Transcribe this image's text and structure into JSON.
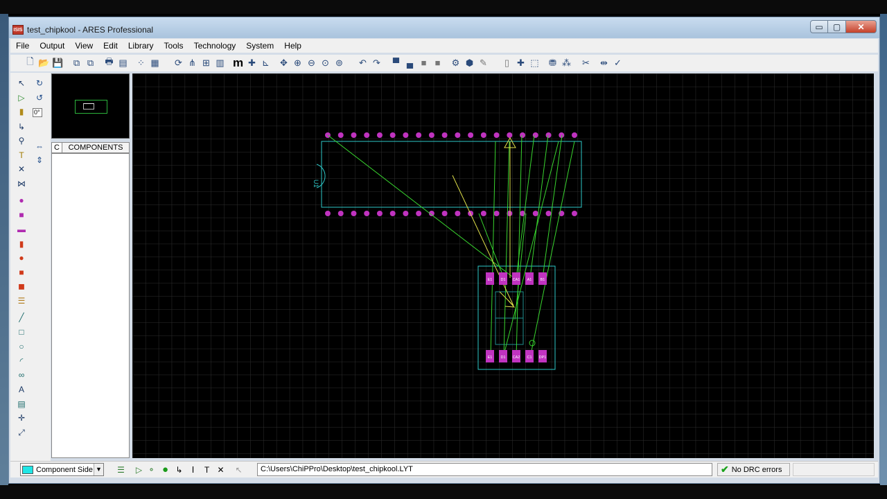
{
  "window": {
    "title": "test_chipkool - ARES Professional",
    "app_icon_text": "ISIS"
  },
  "window_controls": {
    "minimize": "▭",
    "maximize": "▢",
    "close": "✕"
  },
  "menu": [
    {
      "label": "File"
    },
    {
      "label": "Output"
    },
    {
      "label": "View"
    },
    {
      "label": "Edit"
    },
    {
      "label": "Library"
    },
    {
      "label": "Tools"
    },
    {
      "label": "Technology"
    },
    {
      "label": "System"
    },
    {
      "label": "Help"
    }
  ],
  "toolbar": {
    "items": [
      {
        "name": "new-icon",
        "glyph": "🗋"
      },
      {
        "name": "open-icon",
        "glyph": "📂"
      },
      {
        "name": "save-icon",
        "glyph": "💾"
      },
      {
        "name": "import-icon",
        "glyph": "⧉"
      },
      {
        "name": "export-icon",
        "glyph": "⧉"
      },
      {
        "name": "print-icon",
        "glyph": "🖶"
      },
      {
        "name": "print-area-icon",
        "glyph": "▤"
      },
      {
        "name": "grid-dots-icon",
        "glyph": "⁘"
      },
      {
        "name": "grid-icon",
        "glyph": "▦"
      },
      {
        "name": "refresh-icon",
        "glyph": "⟳"
      },
      {
        "name": "mirror-icon",
        "glyph": "⋔"
      },
      {
        "name": "snap-grid-icon",
        "glyph": "⊞"
      },
      {
        "name": "layers-icon",
        "glyph": "▥"
      },
      {
        "name": "metric-icon",
        "glyph": "m"
      },
      {
        "name": "origin-icon",
        "glyph": "✚"
      },
      {
        "name": "cursor-origin-icon",
        "glyph": "⊾"
      },
      {
        "name": "pan-icon",
        "glyph": "✥"
      },
      {
        "name": "zoom-in-icon",
        "glyph": "⊕"
      },
      {
        "name": "zoom-out-icon",
        "glyph": "⊖"
      },
      {
        "name": "zoom-all-icon",
        "glyph": "⊙"
      },
      {
        "name": "zoom-area-icon",
        "glyph": "⊚"
      },
      {
        "name": "undo-icon",
        "glyph": "↶"
      },
      {
        "name": "redo-icon",
        "glyph": "↷"
      },
      {
        "name": "block-copy-icon",
        "glyph": "▀"
      },
      {
        "name": "block-move-icon",
        "glyph": "▄"
      },
      {
        "name": "block-rotate-icon",
        "glyph": "■"
      },
      {
        "name": "block-delete-icon",
        "glyph": "■"
      },
      {
        "name": "pick-library-icon",
        "glyph": "⚙"
      },
      {
        "name": "make-package-icon",
        "glyph": "⬢"
      },
      {
        "name": "decompose-icon",
        "glyph": "✎"
      },
      {
        "name": "page-icon",
        "glyph": "▯"
      },
      {
        "name": "autoplace-icon",
        "glyph": "✚"
      },
      {
        "name": "autoroute-icon",
        "glyph": "⬚"
      },
      {
        "name": "search-tag-icon",
        "glyph": "⛃"
      },
      {
        "name": "property-assign-icon",
        "glyph": "⁂"
      },
      {
        "name": "gateswap-icon",
        "glyph": "✂"
      },
      {
        "name": "tidy-icon",
        "glyph": "⇹"
      },
      {
        "name": "drc-check-icon",
        "glyph": "✓"
      }
    ]
  },
  "side_toolbar": {
    "angle_value": "0°",
    "items": [
      {
        "name": "selection-mode-icon",
        "glyph": "↖"
      },
      {
        "name": "component-mode-icon",
        "glyph": "▷"
      },
      {
        "name": "package-mode-icon",
        "glyph": "▮"
      },
      {
        "name": "track-mode-icon",
        "glyph": "↳"
      },
      {
        "name": "via-mode-icon",
        "glyph": "⚲"
      },
      {
        "name": "zone-mode-icon",
        "glyph": "T"
      },
      {
        "name": "ratsnest-mode-icon",
        "glyph": "✕"
      },
      {
        "name": "connectivity-mode-icon",
        "glyph": "⋈"
      },
      {
        "name": "round-pad-icon",
        "glyph": "●"
      },
      {
        "name": "square-pad-icon",
        "glyph": "■"
      },
      {
        "name": "dil-pad-icon",
        "glyph": "▬"
      },
      {
        "name": "edge-pad-icon",
        "glyph": "▮"
      },
      {
        "name": "circular-smt-pad-icon",
        "glyph": "●"
      },
      {
        "name": "rectangular-smt-pad-icon",
        "glyph": "■"
      },
      {
        "name": "polygonal-smt-pad-icon",
        "glyph": "◼"
      },
      {
        "name": "padstack-icon",
        "glyph": "☰"
      },
      {
        "name": "line-icon",
        "glyph": "╱"
      },
      {
        "name": "box-icon",
        "glyph": "□"
      },
      {
        "name": "circle-icon",
        "glyph": "○"
      },
      {
        "name": "arc-icon",
        "glyph": "◜"
      },
      {
        "name": "path-icon",
        "glyph": "∞"
      },
      {
        "name": "text-icon",
        "glyph": "A"
      },
      {
        "name": "symbol-icon",
        "glyph": "▤"
      },
      {
        "name": "marker-icon",
        "glyph": "✛"
      },
      {
        "name": "dimension-icon",
        "glyph": "⤢"
      }
    ],
    "rotate_icons": [
      {
        "name": "rotate-clockwise-icon",
        "glyph": "↻"
      },
      {
        "name": "rotate-anticlockwise-icon",
        "glyph": "↺"
      },
      {
        "name": "flip-horizontal-icon",
        "glyph": "⇔"
      },
      {
        "name": "flip-vertical-icon",
        "glyph": "⇕"
      }
    ]
  },
  "component_panel": {
    "tab_letter": "C",
    "title": "COMPONENTS"
  },
  "pcb": {
    "colors": {
      "grid": "#2e2e2e",
      "outline": "#2ec8c8",
      "pad": "#c033c0",
      "ratsnest": "#39d62f",
      "force_vector": "#e2e24a",
      "background": "#000000"
    },
    "dip_pad_count": 20,
    "smd_top_labels": [
      "E1",
      "D1",
      "CA1",
      "A1",
      "B1"
    ],
    "smd_bottom_labels": [
      "E1",
      "D1",
      "CA2",
      "C1",
      "DP1"
    ],
    "chip_label": "U1"
  },
  "status": {
    "layer": "Component Side",
    "file_path": "C:\\Users\\ChiPPro\\Desktop\\test_chipkool.LYT",
    "drc": "No DRC errors"
  }
}
